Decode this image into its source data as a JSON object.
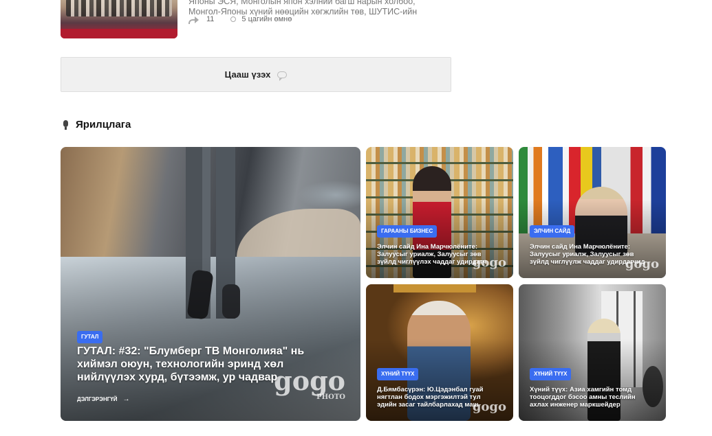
{
  "top_item": {
    "text_line1": "Японы ЭСЯ, Монголын япон хэлний багш нарын холбоо,",
    "text_line2": "Монгол-Японы хүний нөөцийн хөгжлийн төв, ШУТИС-ийн",
    "share_count": "11",
    "time_ago": "5 цагийн өмнө",
    "icons": [
      "share-icon",
      "clock-icon"
    ]
  },
  "more_button": {
    "label": "Цааш үзэх",
    "icon": "chat-bubble-icon"
  },
  "section": {
    "title": "Ярилцлага",
    "icon": "microphone-icon"
  },
  "featured": {
    "category": "ГУТАЛ",
    "title": "ГУТАЛ: #32: \"Блумберг ТВ Монголияа\" нь хиймэл оюун, технологийн эринд хөл нийлүүлэх хурд, бүтээмж, ур чадвар",
    "read_more": "ДЭЛГЭРЭНГҮЙ",
    "watermark": "gogo",
    "watermark_sub": "PHOTO"
  },
  "cards": [
    {
      "category": "ГАРААНЫ БИЗНЕС",
      "title": "Элчин сайд Ина Марчюлёните: Залуусыг уриалж, Залуусыг зөв зүйлд чиглүүлэх чаддаг удирдагч",
      "watermark": "gogo"
    },
    {
      "category": "ЭЛЧИН САЙД",
      "title": "Элчин сайд Ина Марчюлёните: Залуусыг уриалж, Залуусыг зөв зүйлд чиглүүлж чаддаг удирдагчид",
      "watermark": "gogo"
    },
    {
      "category": "ХҮНИЙ ТҮҮХ",
      "title": "Д.Бямбасүрэн: Ю.Цэдэнбал гуай нягтлан бодох мэргэжилтэй тул эдийн засаг тайлбарлахад маш",
      "watermark": "gogo"
    },
    {
      "category": "ХҮНИЙ ТҮҮХ",
      "title": "Хүний түүх: Азиа хамгийн томд тооцогддог бэсоо амны теслийн ахлах инженер маркшейдер"
    }
  ],
  "colors": {
    "badge": "#3a6df0",
    "button_bg": "#f0f0f0"
  }
}
